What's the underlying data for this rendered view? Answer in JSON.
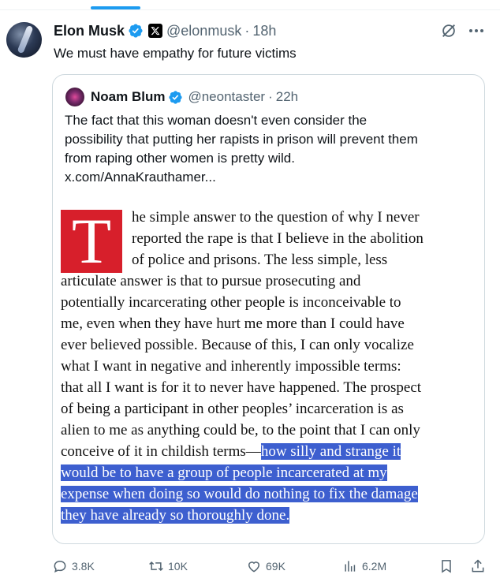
{
  "tweet": {
    "author_name": "Elon Musk",
    "author_handle": "@elonmusk",
    "separator": "·",
    "time": "18h",
    "text": "We must have empathy for future victims"
  },
  "quote": {
    "author_name": "Noam Blum",
    "author_handle": "@neontaster",
    "separator": "·",
    "time": "22h",
    "text_lines": [
      "The fact that this woman doesn't even consider the",
      "possibility that putting her rapists in prison will prevent them",
      "from raping other women is pretty wild.",
      "x.com/AnnaKrauthamer..."
    ],
    "article": {
      "drop_cap": "T",
      "lines": [
        "he simple answer to the question of why I never",
        "reported the rape is that I believe in the abolition",
        "of police and prisons. The less simple, less",
        "articulate answer is that to pursue prosecuting and",
        "potentially incarcerating other people is inconceivable to",
        "me, even when they have hurt me more than I could have",
        "ever believed possible. Because of this, I can only vocalize",
        "what I want in negative and inherently impossible terms:",
        "that all I want is for it to never have happened. The prospect",
        "of being a participant in other peoples’ incarceration is as",
        "alien to me as anything could be, to the point that I can only"
      ],
      "line_12_plain": "conceive of it in childish terms—",
      "line_12_highlight": "how silly and strange it",
      "highlight_lines": [
        "would be to have a group of people incarcerated at my",
        "expense when doing so would do nothing to fix the damage",
        "they have already so thoroughly done."
      ]
    }
  },
  "actions": {
    "replies": "3.8K",
    "reposts": "10K",
    "likes": "69K",
    "views": "6.2M"
  },
  "colors": {
    "accent": "#1d9bf0",
    "verified": "#1d9bf0",
    "drop_cap_bg": "#d71f2b",
    "highlight": "#3d5fcf",
    "secondary_text": "#536471"
  },
  "icons": [
    "verified-badge-icon",
    "x-logo-icon",
    "grok-icon",
    "more-icon",
    "reply-icon",
    "repost-icon",
    "like-icon",
    "views-icon",
    "bookmark-icon",
    "share-icon"
  ]
}
